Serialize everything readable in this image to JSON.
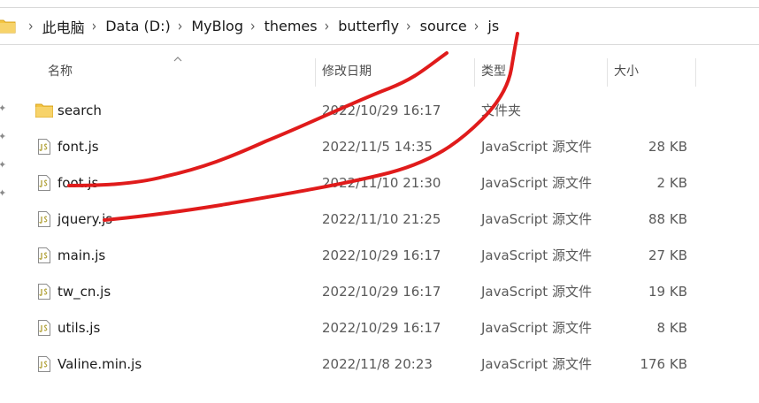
{
  "breadcrumb": {
    "items": [
      {
        "label": "此电脑"
      },
      {
        "label": "Data (D:)"
      },
      {
        "label": "MyBlog"
      },
      {
        "label": "themes"
      },
      {
        "label": "butterfly"
      },
      {
        "label": "source"
      },
      {
        "label": "js"
      }
    ]
  },
  "columns": {
    "name": "名称",
    "date": "修改日期",
    "type": "类型",
    "size": "大小"
  },
  "files": [
    {
      "name": "search",
      "date": "2022/10/29 16:17",
      "type": "文件夹",
      "size": "",
      "icon": "folder-icon"
    },
    {
      "name": "font.js",
      "date": "2022/11/5 14:35",
      "type": "JavaScript 源文件",
      "size": "28 KB",
      "icon": "js-file-icon"
    },
    {
      "name": "foot.js",
      "date": "2022/11/10 21:30",
      "type": "JavaScript 源文件",
      "size": "2 KB",
      "icon": "js-file-icon"
    },
    {
      "name": "jquery.js",
      "date": "2022/11/10 21:25",
      "type": "JavaScript 源文件",
      "size": "88 KB",
      "icon": "js-file-icon"
    },
    {
      "name": "main.js",
      "date": "2022/10/29 16:17",
      "type": "JavaScript 源文件",
      "size": "27 KB",
      "icon": "js-file-icon"
    },
    {
      "name": "tw_cn.js",
      "date": "2022/10/29 16:17",
      "type": "JavaScript 源文件",
      "size": "19 KB",
      "icon": "js-file-icon"
    },
    {
      "name": "utils.js",
      "date": "2022/10/29 16:17",
      "type": "JavaScript 源文件",
      "size": "8 KB",
      "icon": "js-file-icon"
    },
    {
      "name": "Valine.min.js",
      "date": "2022/11/8 20:23",
      "type": "JavaScript 源文件",
      "size": "176 KB",
      "icon": "js-file-icon"
    }
  ],
  "colors": {
    "folder": "#f4c542",
    "annotation": "#e01b1b",
    "js_icon": "#b5a642"
  }
}
